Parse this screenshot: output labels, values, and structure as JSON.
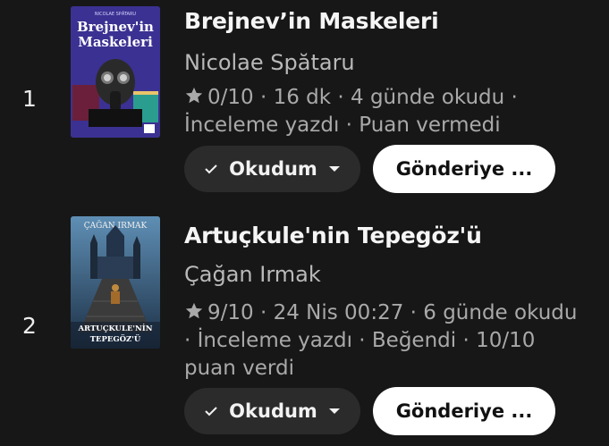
{
  "books": [
    {
      "rank": "1",
      "title": "Brejnev’in Maskeleri",
      "author": "Nicolae Spătaru",
      "meta": "0/10 · 16 dk · 4 günde okudu · İnceleme yazdı · Puan vermedi",
      "status_label": "Okudum",
      "send_label": "Gönderiye ...",
      "cover": {
        "top_text": "NICOLAE SPĂTARU",
        "title_line1": "Brejnev'in",
        "title_line2": "Maskeleri",
        "bg_color": "#3a2f8c"
      }
    },
    {
      "rank": "2",
      "title": "Artuçkule'nin Tepegöz'ü",
      "author": "Çağan Irmak",
      "meta": "9/10 · 24 Nis 00:27 · 6 günde okudu · İnceleme yazdı · Beğendi · 10/10 puan verdi",
      "status_label": "Okudum",
      "send_label": "Gönderiye ...",
      "cover": {
        "top_text": "ÇAĞAN IRMAK",
        "title_line1": "ARTUÇKULE'NİN",
        "title_line2": "TEPEGÖZ'Ü",
        "bg_color": "#2c4a6e"
      }
    }
  ]
}
